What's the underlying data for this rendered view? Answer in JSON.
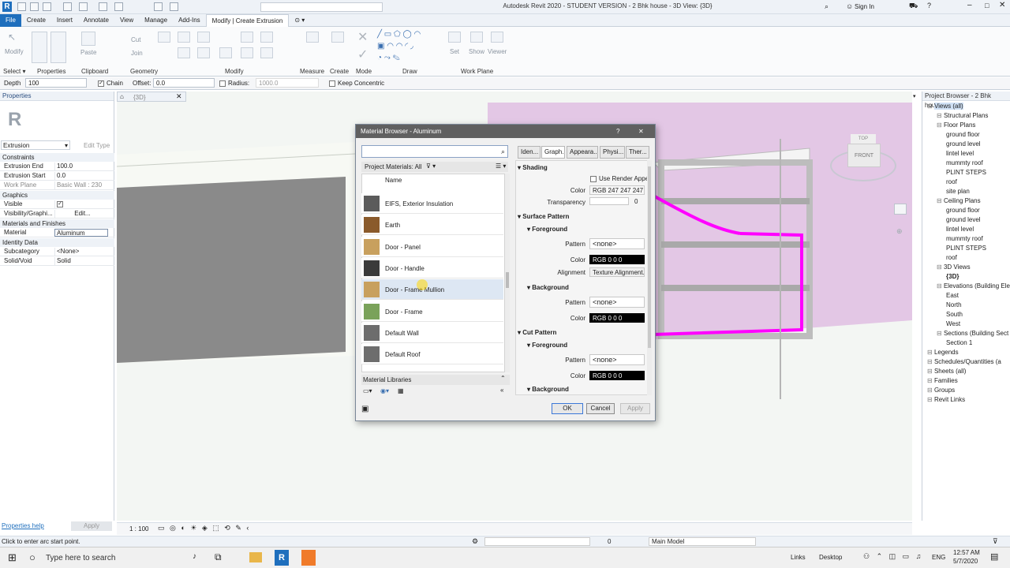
{
  "window": {
    "app_title": "Autodesk Revit 2020 - STUDENT VERSION - 2 Bhk house - 3D View: {3D}",
    "sign_in": "Sign In"
  },
  "ribbon": {
    "tabs": [
      "File",
      "Create",
      "Insert",
      "Annotate",
      "View",
      "Manage",
      "Add-Ins",
      "Modify | Create Extrusion"
    ],
    "active_tab": "Modify | Create Extrusion",
    "panels": [
      "Select",
      "Properties",
      "Clipboard",
      "Geometry",
      "Modify",
      "Measure",
      "Create",
      "Mode",
      "Draw",
      "Work Plane"
    ],
    "button_labels": {
      "modify": "Modify",
      "paste": "Paste",
      "cut": "Cut",
      "join": "Join",
      "set": "Set",
      "show": "Show",
      "viewer": "Viewer"
    }
  },
  "options_bar": {
    "depth_label": "Depth",
    "depth_value": "100",
    "chain_label": "Chain",
    "offset_label": "Offset:",
    "offset_value": "0.0",
    "radius_label": "Radius:",
    "radius_value": "1000.0",
    "keep_concentric_label": "Keep Concentric"
  },
  "properties": {
    "title": "Properties",
    "type_selector": "Extrusion",
    "edit_type": "Edit Type",
    "sections": {
      "constraints": "Constraints",
      "graphics": "Graphics",
      "materials": "Materials and Finishes",
      "identity": "Identity Data"
    },
    "rows": {
      "extrusion_end": {
        "k": "Extrusion End",
        "v": "100.0"
      },
      "extrusion_start": {
        "k": "Extrusion Start",
        "v": "0.0"
      },
      "work_plane": {
        "k": "Work Plane",
        "v": "Basic Wall : 230 ..."
      },
      "visible": {
        "k": "Visible",
        "v": ""
      },
      "visibility": {
        "k": "Visibility/Graphi...",
        "v": "Edit..."
      },
      "material": {
        "k": "Material",
        "v": "Aluminum"
      },
      "subcategory": {
        "k": "Subcategory",
        "v": "<None>"
      },
      "solid_void": {
        "k": "Solid/Void",
        "v": "Solid"
      }
    },
    "help_link": "Properties help",
    "apply": "Apply"
  },
  "view": {
    "tab_label": "{3D}",
    "viewcube_top": "TOP",
    "viewcube_front": "FRONT",
    "scale": "1 : 100"
  },
  "material_browser": {
    "title": "Material Browser - Aluminum",
    "help": "?",
    "close": "✕",
    "search_placeholder": "",
    "project_materials_label": "Project Materials: All",
    "name_header": "Name",
    "materials": [
      {
        "name": "EIFS, Exterior Insulation",
        "color": "#5b5b5b"
      },
      {
        "name": "Earth",
        "color": "#8a5a2b"
      },
      {
        "name": "Door - Panel",
        "color": "#c8a05e"
      },
      {
        "name": "Door - Handle",
        "color": "#3a3a3a"
      },
      {
        "name": "Door - Frame Mullion",
        "color": "#c8a05e"
      },
      {
        "name": "Door - Frame",
        "color": "#7aa25a"
      },
      {
        "name": "Default Wall",
        "color": "#6d6d6d"
      },
      {
        "name": "Default Roof",
        "color": "#6d6d6d"
      }
    ],
    "hover_index": 4,
    "libraries_label": "Material Libraries",
    "editor_tabs": [
      "Iden...",
      "Graph...",
      "Appeara...",
      "Physi...",
      "Ther..."
    ],
    "selected_editor_tab": "Graph...",
    "shading": {
      "title": "Shading",
      "use_render_label": "Use Render Appe",
      "color_label": "Color",
      "color_value": "RGB 247 247 247",
      "transparency_label": "Transparency",
      "transparency_value": "0"
    },
    "surface_pattern": {
      "title": "Surface Pattern",
      "foreground": "Foreground",
      "pattern_label": "Pattern",
      "pattern_value": "<none>",
      "color_label": "Color",
      "color_value": "RGB 0 0 0",
      "alignment_label": "Alignment",
      "alignment_value": "Texture Alignment...",
      "background": "Background",
      "bg_pattern_value": "<none>",
      "bg_color_value": "RGB 0 0 0"
    },
    "cut_pattern": {
      "title": "Cut Pattern",
      "foreground": "Foreground",
      "pattern_label": "Pattern",
      "pattern_value": "<none>",
      "color_label": "Color",
      "color_value": "RGB 0 0 0",
      "background": "Background"
    },
    "ok": "OK",
    "cancel": "Cancel",
    "apply": "Apply"
  },
  "project_browser": {
    "title": "Project Browser - 2 Bhk house",
    "items": [
      {
        "label": "Views (all)",
        "level": 0
      },
      {
        "label": "Structural Plans",
        "level": 1
      },
      {
        "label": "Floor Plans",
        "level": 1
      },
      {
        "label": "ground floor",
        "level": 2
      },
      {
        "label": "ground level",
        "level": 2
      },
      {
        "label": "lintel level",
        "level": 2
      },
      {
        "label": "mummty roof",
        "level": 2
      },
      {
        "label": "PLINT STEPS",
        "level": 2
      },
      {
        "label": "roof",
        "level": 2
      },
      {
        "label": "site plan",
        "level": 2
      },
      {
        "label": "Ceiling Plans",
        "level": 1
      },
      {
        "label": "ground floor",
        "level": 2
      },
      {
        "label": "ground level",
        "level": 2
      },
      {
        "label": "lintel level",
        "level": 2
      },
      {
        "label": "mummty roof",
        "level": 2
      },
      {
        "label": "PLINT STEPS",
        "level": 2
      },
      {
        "label": "roof",
        "level": 2
      },
      {
        "label": "3D Views",
        "level": 1
      },
      {
        "label": "{3D}",
        "level": 2
      },
      {
        "label": "Elevations (Building Ele",
        "level": 1
      },
      {
        "label": "East",
        "level": 2
      },
      {
        "label": "North",
        "level": 2
      },
      {
        "label": "South",
        "level": 2
      },
      {
        "label": "West",
        "level": 2
      },
      {
        "label": "Sections (Building Sect",
        "level": 1
      },
      {
        "label": "Section 1",
        "level": 2
      },
      {
        "label": "Legends",
        "level": 0
      },
      {
        "label": "Schedules/Quantities (a",
        "level": 0
      },
      {
        "label": "Sheets (all)",
        "level": 0
      },
      {
        "label": "Families",
        "level": 0
      },
      {
        "label": "Groups",
        "level": 0
      },
      {
        "label": "Revit Links",
        "level": 0
      }
    ]
  },
  "status": {
    "message": "Click to enter arc start point.",
    "workset": "0",
    "model": "Main Model"
  },
  "taskbar": {
    "search_placeholder": "Type here to search",
    "links": "Links",
    "desktop": "Desktop",
    "lang": "ENG",
    "time": "12:57 AM",
    "date": "5/7/2020"
  },
  "colors": {
    "accent": "#1f6fbd",
    "magenta": "#ff00ff",
    "wall_pink": "#e3c7e5",
    "dialog_title": "#606060"
  }
}
